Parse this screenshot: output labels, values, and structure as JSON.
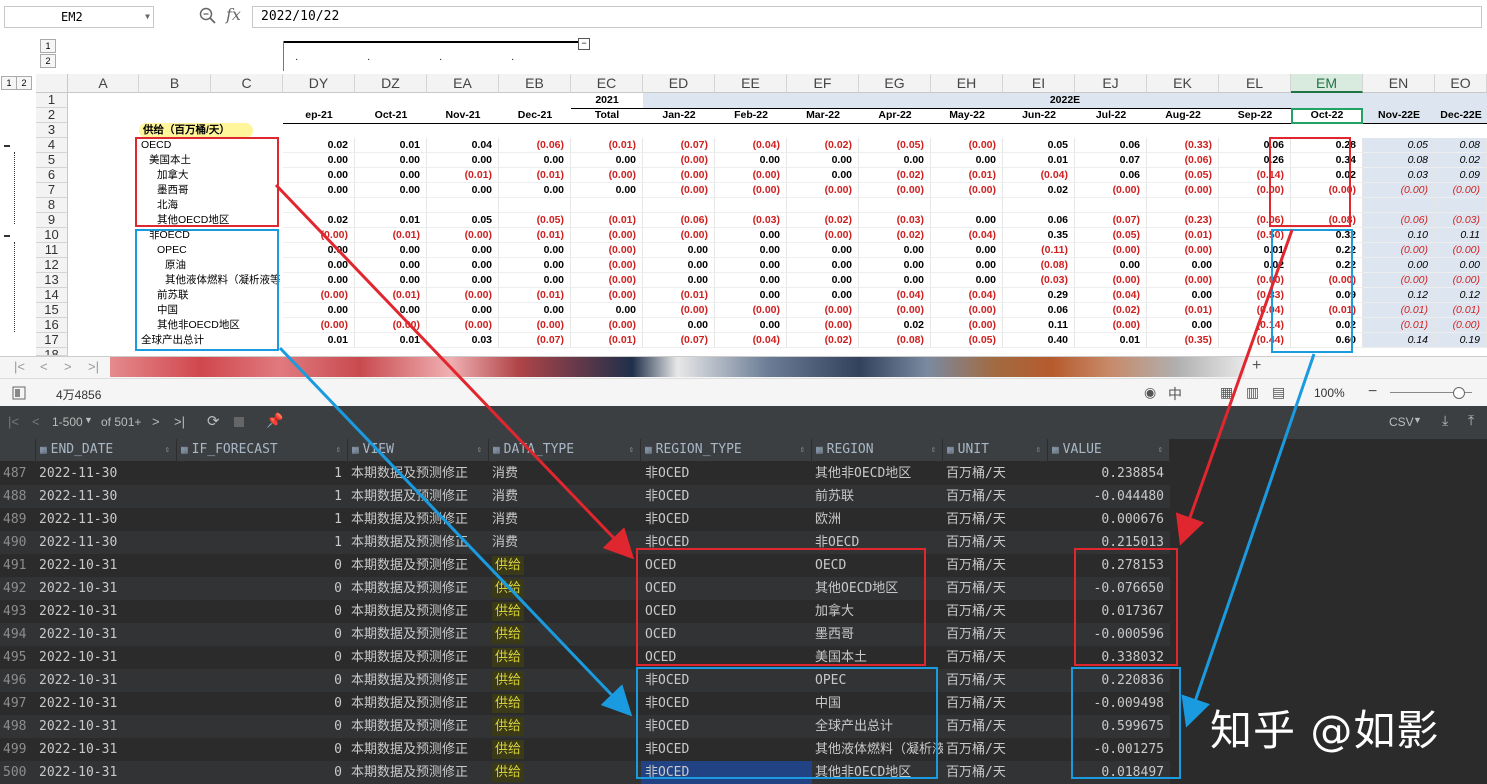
{
  "formula_bar": {
    "name_box": "EM2",
    "fx_label": "fx",
    "value": "2022/10/22"
  },
  "outline": {
    "levels": [
      "1",
      "2"
    ],
    "row_levels": [
      "1",
      "2"
    ]
  },
  "columns": [
    "A",
    "B",
    "C",
    "DY",
    "DZ",
    "EA",
    "EB",
    "EC",
    "ED",
    "EE",
    "EF",
    "EG",
    "EH",
    "EI",
    "EJ",
    "EK",
    "EL",
    "EM",
    "EN",
    "EO"
  ],
  "selected_column": "EM",
  "row1": {
    "ec": "2021",
    "ed_merge": "2022E"
  },
  "row2": {
    "dy": "ep-21",
    "dz": "Oct-21",
    "ea": "Nov-21",
    "eb": "Dec-21",
    "ec": "Total",
    "ed": "Jan-22",
    "ee": "Feb-22",
    "ef": "Mar-22",
    "eg": "Apr-22",
    "eh": "May-22",
    "ei": "Jun-22",
    "ej": "Jul-22",
    "ek": "Aug-22",
    "el": "Sep-22",
    "em": "Oct-22",
    "en": "Nov-22E",
    "eo": "Dec-22E"
  },
  "row3_label": "供给（百万桶/天）",
  "sheet_rows": [
    {
      "n": "4",
      "label": "OECD",
      "indent": 0,
      "v": [
        "0.02",
        "0.01",
        "0.04",
        "(0.06)",
        "(0.01)",
        "(0.07)",
        "(0.04)",
        "(0.02)",
        "(0.05)",
        "(0.00)",
        "0.05",
        "0.06",
        "(0.33)",
        "0.06",
        "0.28",
        "0.05",
        "0.08"
      ]
    },
    {
      "n": "5",
      "label": "美国本土",
      "indent": 1,
      "v": [
        "0.00",
        "0.00",
        "0.00",
        "0.00",
        "0.00",
        "(0.00)",
        "0.00",
        "0.00",
        "0.00",
        "0.00",
        "0.01",
        "0.07",
        "(0.06)",
        "0.26",
        "0.34",
        "0.08",
        "0.02"
      ]
    },
    {
      "n": "6",
      "label": "加拿大",
      "indent": 2,
      "v": [
        "0.00",
        "0.00",
        "(0.01)",
        "(0.01)",
        "(0.00)",
        "(0.00)",
        "(0.00)",
        "0.00",
        "(0.02)",
        "(0.01)",
        "(0.04)",
        "0.06",
        "(0.05)",
        "(0.14)",
        "0.02",
        "0.03",
        "0.09"
      ]
    },
    {
      "n": "7",
      "label": "墨西哥",
      "indent": 2,
      "v": [
        "0.00",
        "0.00",
        "0.00",
        "0.00",
        "0.00",
        "(0.00)",
        "(0.00)",
        "(0.00)",
        "(0.00)",
        "(0.00)",
        "0.02",
        "(0.00)",
        "(0.00)",
        "(0.00)",
        "(0.00)",
        "(0.00)",
        "(0.00)"
      ]
    },
    {
      "n": "8",
      "label": "北海",
      "indent": 2,
      "v": [
        "",
        "",
        "",
        "",
        "",
        "",
        "",
        "",
        "",
        "",
        "",
        "",
        "",
        "",
        "",
        "",
        ""
      ]
    },
    {
      "n": "9",
      "label": "其他OECD地区",
      "indent": 2,
      "v": [
        "0.02",
        "0.01",
        "0.05",
        "(0.05)",
        "(0.01)",
        "(0.06)",
        "(0.03)",
        "(0.02)",
        "(0.03)",
        "0.00",
        "0.06",
        "(0.07)",
        "(0.23)",
        "(0.06)",
        "(0.08)",
        "(0.06)",
        "(0.03)"
      ]
    },
    {
      "n": "10",
      "label": "非OECD",
      "indent": 1,
      "v": [
        "(0.00)",
        "(0.01)",
        "(0.00)",
        "(0.01)",
        "(0.00)",
        "(0.00)",
        "0.00",
        "(0.00)",
        "(0.02)",
        "(0.04)",
        "0.35",
        "(0.05)",
        "(0.01)",
        "(0.50)",
        "0.32",
        "0.10",
        "0.11"
      ]
    },
    {
      "n": "11",
      "label": "OPEC",
      "indent": 2,
      "v": [
        "0.00",
        "0.00",
        "0.00",
        "0.00",
        "(0.00)",
        "0.00",
        "0.00",
        "0.00",
        "0.00",
        "0.00",
        "(0.11)",
        "(0.00)",
        "(0.00)",
        "0.01",
        "0.22",
        "(0.00)",
        "(0.00)"
      ]
    },
    {
      "n": "12",
      "label": "原油",
      "indent": 3,
      "v": [
        "0.00",
        "0.00",
        "0.00",
        "0.00",
        "(0.00)",
        "0.00",
        "0.00",
        "0.00",
        "0.00",
        "0.00",
        "(0.08)",
        "0.00",
        "0.00",
        "0.02",
        "0.22",
        "0.00",
        "0.00"
      ]
    },
    {
      "n": "13",
      "label": "其他液体燃料（凝析液等",
      "indent": 3,
      "v": [
        "0.00",
        "0.00",
        "0.00",
        "0.00",
        "(0.00)",
        "0.00",
        "0.00",
        "0.00",
        "0.00",
        "0.00",
        "(0.03)",
        "(0.00)",
        "(0.00)",
        "(0.00)",
        "(0.00)",
        "(0.00)",
        "(0.00)"
      ]
    },
    {
      "n": "14",
      "label": "前苏联",
      "indent": 2,
      "v": [
        "(0.00)",
        "(0.01)",
        "(0.00)",
        "(0.01)",
        "(0.00)",
        "(0.01)",
        "0.00",
        "0.00",
        "(0.04)",
        "(0.04)",
        "0.29",
        "(0.04)",
        "0.00",
        "(0.33)",
        "0.09",
        "0.12",
        "0.12"
      ]
    },
    {
      "n": "15",
      "label": "中国",
      "indent": 2,
      "v": [
        "0.00",
        "0.00",
        "0.00",
        "0.00",
        "0.00",
        "(0.00)",
        "(0.00)",
        "(0.00)",
        "(0.00)",
        "(0.00)",
        "0.06",
        "(0.02)",
        "(0.01)",
        "(0.04)",
        "(0.01)",
        "(0.01)",
        "(0.01)"
      ]
    },
    {
      "n": "16",
      "label": "其他非OECD地区",
      "indent": 2,
      "v": [
        "(0.00)",
        "(0.00)",
        "(0.00)",
        "(0.00)",
        "(0.00)",
        "0.00",
        "0.00",
        "(0.00)",
        "0.02",
        "(0.00)",
        "0.11",
        "(0.00)",
        "0.00",
        "(0.14)",
        "0.02",
        "(0.01)",
        "(0.00)"
      ]
    },
    {
      "n": "17",
      "label": "全球产出总计",
      "indent": 0,
      "v": [
        "0.01",
        "0.01",
        "0.03",
        "(0.07)",
        "(0.01)",
        "(0.07)",
        "(0.04)",
        "(0.02)",
        "(0.08)",
        "(0.05)",
        "0.40",
        "0.01",
        "(0.35)",
        "(0.44)",
        "0.60",
        "0.14",
        "0.19"
      ]
    }
  ],
  "row18": "18",
  "status": {
    "cell_info": "4万4856",
    "zoom": "100%"
  },
  "db": {
    "page_range": "1-500",
    "page_of": "of 501+",
    "export": "CSV",
    "columns": [
      "END_DATE",
      "IF_FORECAST",
      "VIEW",
      "DATA_TYPE",
      "REGION_TYPE",
      "REGION",
      "UNIT",
      "VALUE"
    ],
    "rows": [
      [
        "487",
        "2022-11-30",
        "1",
        "本期数据及预测修正",
        "消费",
        "非OCED",
        "其他非OECD地区",
        "百万桶/天",
        "0.238854"
      ],
      [
        "488",
        "2022-11-30",
        "1",
        "本期数据及预测修正",
        "消费",
        "非OCED",
        "前苏联",
        "百万桶/天",
        "-0.044480"
      ],
      [
        "489",
        "2022-11-30",
        "1",
        "本期数据及预测修正",
        "消费",
        "非OCED",
        "欧洲",
        "百万桶/天",
        "0.000676"
      ],
      [
        "490",
        "2022-11-30",
        "1",
        "本期数据及预测修正",
        "消费",
        "非OCED",
        "非OECD",
        "百万桶/天",
        "0.215013"
      ],
      [
        "491",
        "2022-10-31",
        "0",
        "本期数据及预测修正",
        "供给",
        "OCED",
        "OECD",
        "百万桶/天",
        "0.278153"
      ],
      [
        "492",
        "2022-10-31",
        "0",
        "本期数据及预测修正",
        "供给",
        "OCED",
        "其他OECD地区",
        "百万桶/天",
        "-0.076650"
      ],
      [
        "493",
        "2022-10-31",
        "0",
        "本期数据及预测修正",
        "供给",
        "OCED",
        "加拿大",
        "百万桶/天",
        "0.017367"
      ],
      [
        "494",
        "2022-10-31",
        "0",
        "本期数据及预测修正",
        "供给",
        "OCED",
        "墨西哥",
        "百万桶/天",
        "-0.000596"
      ],
      [
        "495",
        "2022-10-31",
        "0",
        "本期数据及预测修正",
        "供给",
        "OCED",
        "美国本土",
        "百万桶/天",
        "0.338032"
      ],
      [
        "496",
        "2022-10-31",
        "0",
        "本期数据及预测修正",
        "供给",
        "非OCED",
        "OPEC",
        "百万桶/天",
        "0.220836"
      ],
      [
        "497",
        "2022-10-31",
        "0",
        "本期数据及预测修正",
        "供给",
        "非OCED",
        "中国",
        "百万桶/天",
        "-0.009498"
      ],
      [
        "498",
        "2022-10-31",
        "0",
        "本期数据及预测修正",
        "供给",
        "非OCED",
        "全球产出总计",
        "百万桶/天",
        "0.599675"
      ],
      [
        "499",
        "2022-10-31",
        "0",
        "本期数据及预测修正",
        "供给",
        "非OCED",
        "其他液体燃料（凝析液",
        "百万桶/天",
        "-0.001275"
      ],
      [
        "500",
        "2022-10-31",
        "0",
        "本期数据及预测修正",
        "供给",
        "非OCED",
        "其他非OECD地区",
        "百万桶/天",
        "0.018497"
      ]
    ]
  },
  "watermark": "知乎 @如影",
  "colors": {
    "red_box": "#e0262e",
    "blue_box": "#1a9be0",
    "accent": "#217346",
    "neg": "#d01f1f"
  }
}
